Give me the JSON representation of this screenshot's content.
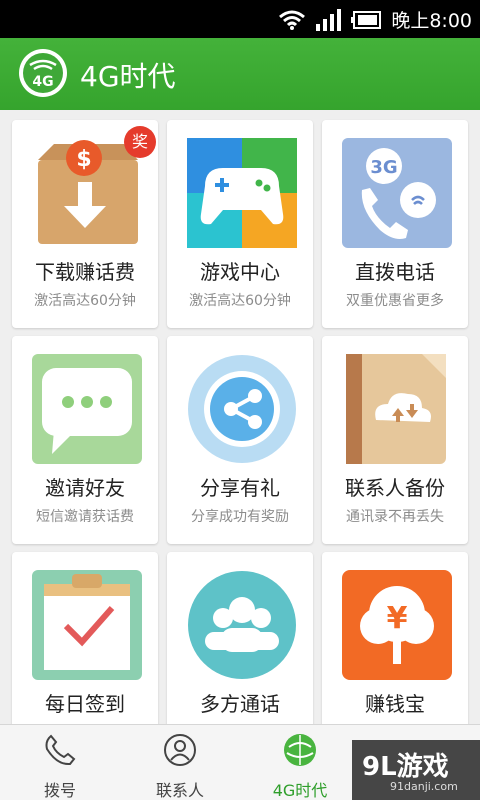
{
  "status_bar": {
    "time": "晚上8:00"
  },
  "header": {
    "title": "4G时代",
    "logo_text": "4G"
  },
  "tiles": [
    {
      "title": "下载赚话费",
      "subtitle": "激活高达60分钟",
      "icon": "download-box-icon",
      "badge": "奖"
    },
    {
      "title": "游戏中心",
      "subtitle": "激活高达60分钟",
      "icon": "gamepad-icon"
    },
    {
      "title": "直拨电话",
      "subtitle": "双重优惠省更多",
      "icon": "3g-call-icon",
      "icon_text": "3G"
    },
    {
      "title": "邀请好友",
      "subtitle": "短信邀请获话费",
      "icon": "chat-bubble-icon"
    },
    {
      "title": "分享有礼",
      "subtitle": "分享成功有奖励",
      "icon": "share-icon"
    },
    {
      "title": "联系人备份",
      "subtitle": "通讯录不再丢失",
      "icon": "contacts-backup-icon"
    },
    {
      "title": "每日签到",
      "icon": "checkin-calendar-icon"
    },
    {
      "title": "多方通话",
      "icon": "group-call-icon"
    },
    {
      "title": "赚钱宝",
      "icon": "money-tree-icon",
      "icon_text": "¥"
    }
  ],
  "tab_bar": [
    {
      "label": "拨号",
      "icon": "phone-icon",
      "active": false
    },
    {
      "label": "联系人",
      "icon": "contact-icon",
      "active": false
    },
    {
      "label": "4G时代",
      "icon": "globe-icon",
      "active": true
    }
  ],
  "watermark": {
    "main": "9L游戏",
    "sub": "91danji.com"
  },
  "colors": {
    "header_green": "#3aab31",
    "active_tab": "#2e9e2a"
  }
}
